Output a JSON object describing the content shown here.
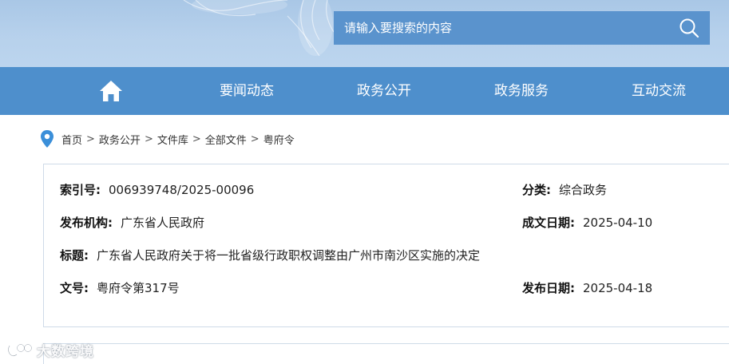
{
  "search": {
    "placeholder": "请输入要搜索的内容"
  },
  "nav": {
    "items": [
      "要闻动态",
      "政务公开",
      "政务服务",
      "互动交流"
    ]
  },
  "breadcrumb": {
    "items": [
      "首页",
      "政务公开",
      "文件库",
      "全部文件",
      "粤府令"
    ],
    "separator": ">"
  },
  "info": {
    "index_label": "索引号:",
    "index_value": "006939748/2025-00096",
    "category_label": "分类:",
    "category_value": "综合政务",
    "publisher_label": "发布机构:",
    "publisher_value": "广东省人民政府",
    "written_date_label": "成文日期:",
    "written_date_value": "2025-04-10",
    "title_label": "标题:",
    "title_value": "广东省人民政府关于将一批省级行政职权调整由广州市南沙区实施的决定",
    "doc_no_label": "文号:",
    "doc_no_value": "粤府令第317号",
    "publish_date_label": "发布日期:",
    "publish_date_value": "2025-04-18"
  },
  "watermark": {
    "text": "大数跨境"
  },
  "colors": {
    "nav_bg": "#4e8fcc",
    "search_bg": "#5a93cd",
    "banner_bg": "#b7d1ec",
    "card_border": "#cfdbe8",
    "pin_blue": "#3b8fd9"
  }
}
